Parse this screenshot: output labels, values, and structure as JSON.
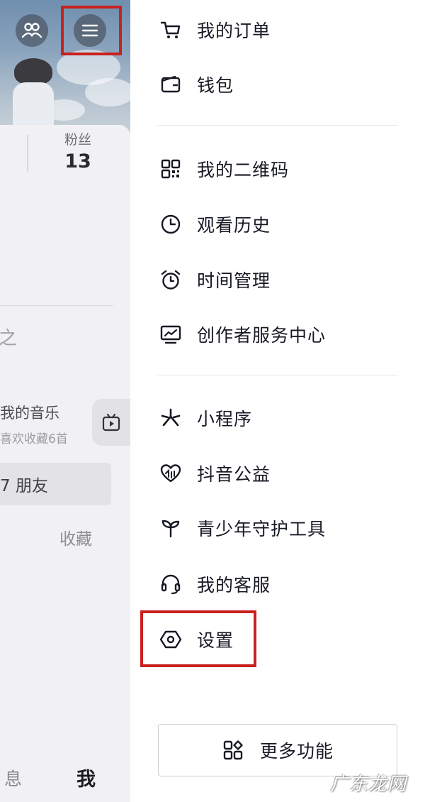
{
  "profile": {
    "fans_label": "粉丝",
    "fans_count": "13",
    "partial_section_char": "之",
    "music_title": "我的音乐",
    "music_subtitle": "喜欢收藏6首",
    "friends_pill": "7 朋友",
    "collect_tab": "收藏",
    "bottom_nav": {
      "messages": "息",
      "me": "我"
    }
  },
  "menu": {
    "group1": [
      {
        "id": "orders",
        "label": "我的订单",
        "icon": "cart-icon"
      },
      {
        "id": "wallet",
        "label": "钱包",
        "icon": "wallet-icon"
      }
    ],
    "group2": [
      {
        "id": "qrcode",
        "label": "我的二维码",
        "icon": "qr-code-icon"
      },
      {
        "id": "history",
        "label": "观看历史",
        "icon": "clock-icon"
      },
      {
        "id": "time",
        "label": "时间管理",
        "icon": "alarm-icon"
      },
      {
        "id": "creator",
        "label": "创作者服务中心",
        "icon": "chart-screen-icon"
      }
    ],
    "group3": [
      {
        "id": "miniapp",
        "label": "小程序",
        "icon": "asterisk-icon"
      },
      {
        "id": "charity",
        "label": "抖音公益",
        "icon": "heart-icon"
      },
      {
        "id": "teen",
        "label": "青少年守护工具",
        "icon": "sprout-icon"
      },
      {
        "id": "service",
        "label": "我的客服",
        "icon": "headset-icon"
      },
      {
        "id": "settings",
        "label": "设置",
        "icon": "hexagon-settings-icon"
      }
    ],
    "more_button": "更多功能"
  },
  "highlight_color": "#c9211e",
  "watermark": "广东龙网"
}
